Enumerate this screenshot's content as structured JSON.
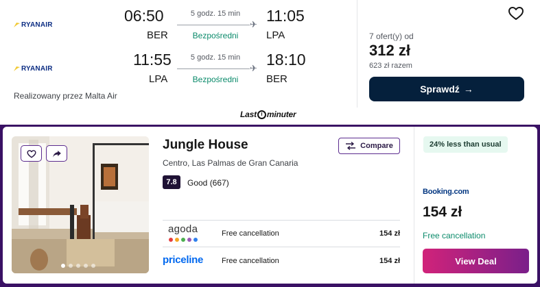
{
  "flight": {
    "outbound": {
      "airline": "RYANAIR",
      "depart_time": "06:50",
      "depart_code": "BER",
      "duration": "5 godz. 15 min",
      "stops": "Bezpośredni",
      "arrive_time": "11:05",
      "arrive_code": "LPA"
    },
    "return": {
      "airline": "RYANAIR",
      "depart_time": "11:55",
      "depart_code": "LPA",
      "duration": "5 godz. 15 min",
      "stops": "Bezpośredni",
      "arrive_time": "18:10",
      "arrive_code": "BER"
    },
    "operated_by": "Realizowany przez Malta Air",
    "offers_label": "7 ofert(y) od",
    "price": "312 zł",
    "price_total": "623 zł razem",
    "check_button": "Sprawdź",
    "check_arrow": "→"
  },
  "lastminuter": {
    "before": "Last",
    "after": "minuter"
  },
  "hotel": {
    "name": "Jungle House",
    "location": "Centro, Las Palmas de Gran Canaria",
    "rating_score": "7.8",
    "rating_text": "Good (667)",
    "compare_label": "Compare",
    "photo_count": 5,
    "photo_active_index": 0,
    "deals": [
      {
        "provider": "agoda",
        "cancellation": "Free cancellation",
        "price": "154 zł"
      },
      {
        "provider": "priceline",
        "cancellation": "Free cancellation",
        "price": "154 zł"
      }
    ],
    "badge": "24% less than usual",
    "main_provider": "Booking.com",
    "main_price": "154 zł",
    "main_cancellation": "Free cancellation",
    "view_deal_label": "View Deal"
  },
  "colors": {
    "accent_dark": "#05203c",
    "hotel_frame": "#3a1164",
    "green": "#0a8a6a",
    "cta_gradient_start": "#d1237a",
    "cta_gradient_end": "#7a1f8a",
    "agoda_dots": [
      "#e63e3e",
      "#f5a623",
      "#4caf50",
      "#9b59b6",
      "#2f80ed"
    ]
  },
  "icons": {
    "airline": "ryanair-harp-icon",
    "plane": "plane-icon",
    "save": "heart-icon",
    "share": "share-arrow-icon",
    "compare": "compare-arrows-icon",
    "clock": "clock-icon"
  }
}
